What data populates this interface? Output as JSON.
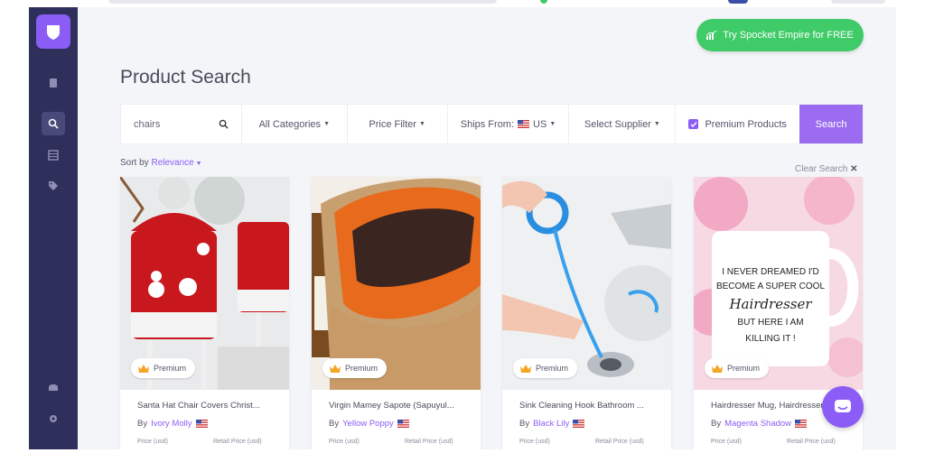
{
  "header": {
    "try_button_label": "Try Spocket Empire for FREE",
    "page_title": "Product Search"
  },
  "search": {
    "query": "chairs",
    "categories_label": "All Categories",
    "price_filter_label": "Price Filter",
    "ships_from_label": "Ships From:",
    "ships_from_value": "US",
    "supplier_label": "Select Supplier",
    "premium_label": "Premium Products",
    "premium_checked": true,
    "search_button": "Search"
  },
  "sort": {
    "label": "Sort by",
    "value": "Relevance",
    "clear_label": "Clear Search"
  },
  "products": [
    {
      "title": "Santa Hat Chair Covers Christ...",
      "by": "By",
      "supplier": "Ivory Molly",
      "badge": "Premium",
      "price_label": "Price (usd)",
      "retail_label": "Retail Price (usd)"
    },
    {
      "title": "Virgin Mamey Sapote (Sapuyul...",
      "by": "By",
      "supplier": "Yellow Poppy",
      "badge": "Premium",
      "price_label": "Price (usd)",
      "retail_label": "Retail Price (usd)"
    },
    {
      "title": "Sink Cleaning Hook Bathroom ...",
      "by": "By",
      "supplier": "Black Lily",
      "badge": "Premium",
      "price_label": "Price (usd)",
      "retail_label": "Retail Price (usd)"
    },
    {
      "title": "Hairdresser Mug, Hairdresser ...",
      "by": "By",
      "supplier": "Magenta Shadow",
      "badge": "Premium",
      "price_label": "Price (usd)",
      "retail_label": "Retail Price (usd)"
    }
  ],
  "mug_text": [
    "I NEVER DREAMED I'D",
    "BECOME A SUPER COOL",
    "Hairdresser",
    "BUT HERE I AM",
    "KILLING IT !"
  ],
  "colors": {
    "sidebar": "#2f2f5b",
    "accent": "#8b5cf6",
    "try_button": "#3fcb68"
  }
}
